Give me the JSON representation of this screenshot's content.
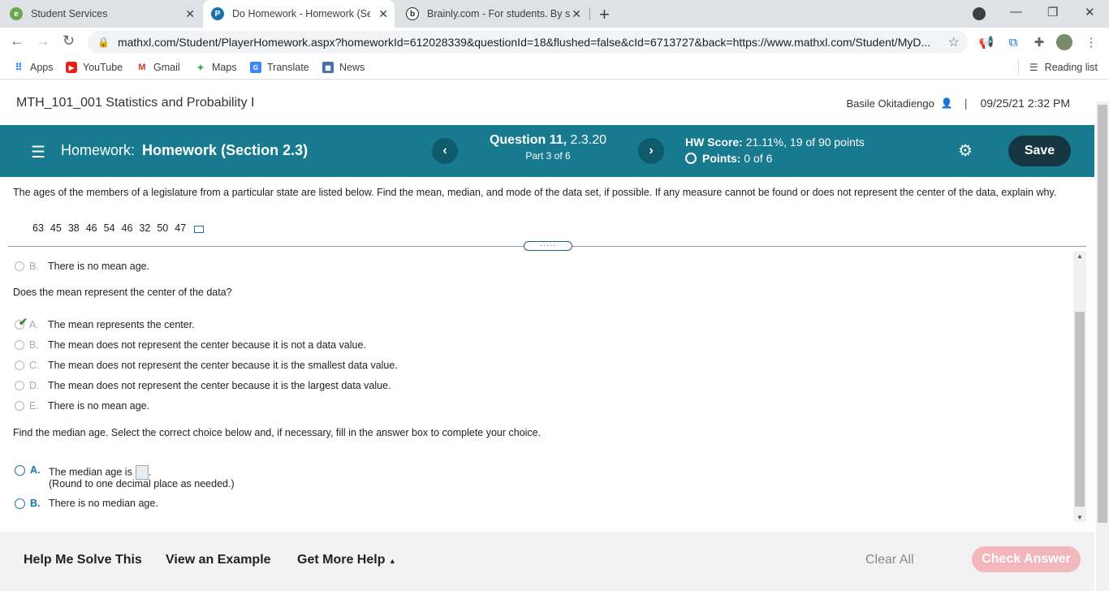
{
  "browser": {
    "tabs": [
      {
        "title": "Student Services",
        "favicon_letter": "e",
        "favicon_color": "#6aa84f"
      },
      {
        "title": "Do Homework - Homework (Sect",
        "favicon_letter": "P",
        "favicon_color": "#1a73a8"
      },
      {
        "title": "Brainly.com - For students. By stu",
        "favicon_letter": "b",
        "favicon_color": "#222222"
      }
    ],
    "url": "mathxl.com/Student/PlayerHomework.aspx?homeworkId=612028339&questionId=18&flushed=false&cId=6713727&back=https://www.mathxl.com/Student/MyD...",
    "bookmarks": [
      "Apps",
      "YouTube",
      "Gmail",
      "Maps",
      "Translate",
      "News"
    ],
    "reading_list": "Reading list"
  },
  "header": {
    "course": "MTH_101_001 Statistics and Probability I",
    "user": "Basile Okitadiengo",
    "separator": "|",
    "datetime": "09/25/21 2:32 PM"
  },
  "hwbar": {
    "label": "Homework:",
    "title": "Homework (Section 2.3)",
    "question_label": "Question 11,",
    "question_id": "2.3.20",
    "part": "Part 3 of 6",
    "score_label": "HW Score:",
    "score_value": "21.11%, 19 of 90 points",
    "points_label": "Points:",
    "points_value": "0 of 6",
    "save": "Save"
  },
  "question": {
    "text": "The ages of the members of a legislature from a particular state are listed below. Find the mean, median, and mode of the data set, if possible. If any measure cannot be found or does not represent the center of the data, explain why.",
    "data": [
      "63",
      "45",
      "38",
      "46",
      "54",
      "46",
      "32",
      "50",
      "47"
    ]
  },
  "part_mean_none": {
    "letter": "B.",
    "text": "There is no mean age."
  },
  "mean_center": {
    "prompt": "Does the mean represent the center of the data?",
    "options": [
      {
        "letter": "A.",
        "text": "The mean represents the center."
      },
      {
        "letter": "B.",
        "text": "The mean does not represent the center because it is not a data value."
      },
      {
        "letter": "C.",
        "text": "The mean does not represent the center because it is the smallest data value."
      },
      {
        "letter": "D.",
        "text": "The mean does not represent the center because it is the largest data value."
      },
      {
        "letter": "E.",
        "text": "There is no mean age."
      }
    ]
  },
  "median": {
    "prompt": "Find the median age. Select the correct choice below and, if necessary, fill in the answer box to complete your choice.",
    "options": [
      {
        "letter": "A.",
        "text": "The median age is",
        "after": ".",
        "note": "(Round to one decimal place as needed.)"
      },
      {
        "letter": "B.",
        "text": "There is no median age."
      }
    ]
  },
  "footer": {
    "help_me": "Help Me Solve This",
    "example": "View an Example",
    "more_help": "Get More Help",
    "clear_all": "Clear All",
    "check_answer": "Check Answer"
  }
}
